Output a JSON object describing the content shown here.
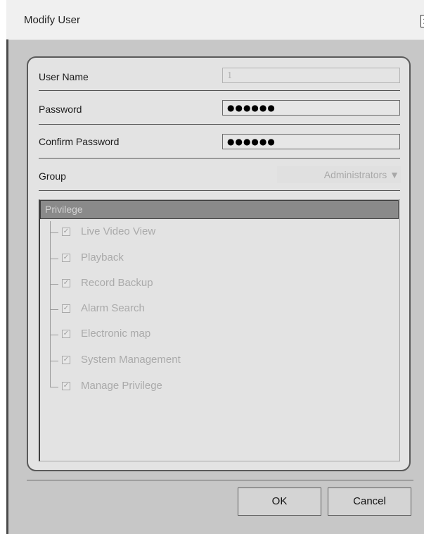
{
  "window": {
    "title": "Modify User",
    "close_glyph": "✕"
  },
  "form": {
    "username": {
      "label": "User Name",
      "value": "1"
    },
    "password": {
      "label": "Password",
      "value": "●●●●●●"
    },
    "confirm_password": {
      "label": "Confirm Password",
      "value": "●●●●●●"
    },
    "group": {
      "label": "Group",
      "selected": "Administrators ▼"
    }
  },
  "privilege": {
    "header": "Privilege",
    "check_glyph": "✓",
    "items": [
      {
        "label": "Live Video View",
        "checked": true
      },
      {
        "label": "Playback",
        "checked": true
      },
      {
        "label": "Record Backup",
        "checked": true
      },
      {
        "label": "Alarm Search",
        "checked": true
      },
      {
        "label": "Electronic map",
        "checked": true
      },
      {
        "label": "System Management",
        "checked": true
      },
      {
        "label": "Manage Privilege",
        "checked": true
      }
    ]
  },
  "buttons": {
    "ok": "OK",
    "cancel": "Cancel"
  }
}
